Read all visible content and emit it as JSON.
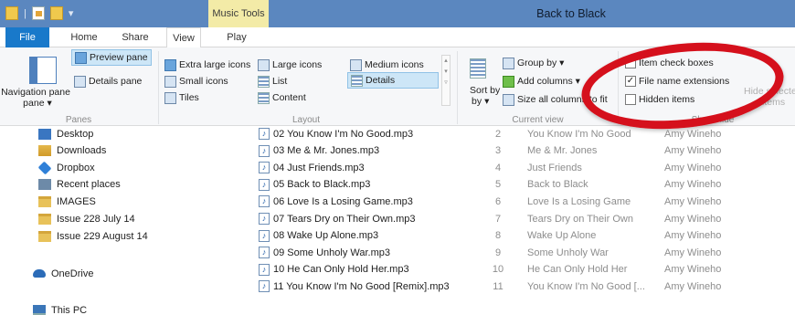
{
  "window": {
    "title": "Back to Black",
    "context_tab": "Music Tools"
  },
  "tabs": [
    {
      "label": "File"
    },
    {
      "label": "Home"
    },
    {
      "label": "Share"
    },
    {
      "label": "View"
    },
    {
      "label": "Play"
    }
  ],
  "ribbon": {
    "panes": {
      "label": "Panes",
      "navigation_pane": "Navigation pane",
      "navigation_pane_arrow": "▾",
      "preview_pane": "Preview pane",
      "details_pane": "Details pane"
    },
    "layout": {
      "label": "Layout",
      "extra_large_icons": "Extra large icons",
      "large_icons": "Large icons",
      "medium_icons": "Medium icons",
      "small_icons": "Small icons",
      "list": "List",
      "details": "Details",
      "tiles": "Tiles",
      "content": "Content"
    },
    "current_view": {
      "label": "Current view",
      "sort_by": "Sort by",
      "sort_by_arrow": "▾",
      "group_by": "Group by ▾",
      "add_columns": "Add columns ▾",
      "size_all_columns": "Size all columns to fit"
    },
    "show_hide": {
      "label": "Show/hide",
      "item_check_boxes": "Item check boxes",
      "item_check_boxes_checked": false,
      "file_name_extensions": "File name extensions",
      "file_name_extensions_checked": true,
      "hidden_items": "Hidden items",
      "hidden_items_checked": false,
      "hide_selected": "Hide selected",
      "hide_selected_sub": "items"
    }
  },
  "nav": {
    "items": [
      {
        "label": "Desktop"
      },
      {
        "label": "Downloads"
      },
      {
        "label": "Dropbox"
      },
      {
        "label": "Recent places"
      },
      {
        "label": "IMAGES"
      },
      {
        "label": "Issue 228 July 14"
      },
      {
        "label": "Issue 229 August 14"
      },
      {
        "label": "OneDrive"
      },
      {
        "label": "This PC"
      }
    ]
  },
  "files": [
    {
      "name": "02 You Know I'm No Good.mp3",
      "num": "2",
      "title": "You Know I'm No Good",
      "artist": "Amy Wineho"
    },
    {
      "name": "03 Me & Mr. Jones.mp3",
      "num": "3",
      "title": "Me & Mr. Jones",
      "artist": "Amy Wineho"
    },
    {
      "name": "04 Just Friends.mp3",
      "num": "4",
      "title": "Just Friends",
      "artist": "Amy Wineho"
    },
    {
      "name": "05 Back to Black.mp3",
      "num": "5",
      "title": "Back to Black",
      "artist": "Amy Wineho"
    },
    {
      "name": "06 Love Is a Losing Game.mp3",
      "num": "6",
      "title": "Love Is a Losing Game",
      "artist": "Amy Wineho"
    },
    {
      "name": "07 Tears Dry on Their Own.mp3",
      "num": "7",
      "title": "Tears Dry on Their Own",
      "artist": "Amy Wineho"
    },
    {
      "name": "08 Wake Up Alone.mp3",
      "num": "8",
      "title": "Wake Up Alone",
      "artist": "Amy Wineho"
    },
    {
      "name": "09 Some Unholy War.mp3",
      "num": "9",
      "title": "Some Unholy War",
      "artist": "Amy Wineho"
    },
    {
      "name": "10 He Can Only Hold Her.mp3",
      "num": "10",
      "title": "He Can Only Hold Her",
      "artist": "Amy Wineho"
    },
    {
      "name": "11 You Know I'm No Good [Remix].mp3",
      "num": "11",
      "title": "You Know I'm No Good [...",
      "artist": "Amy Wineho"
    }
  ],
  "colors": {
    "titlebar": "#5b87bf",
    "file_tab": "#1979ca",
    "context_tab": "#f3eba7",
    "annotation": "#d5101c"
  }
}
